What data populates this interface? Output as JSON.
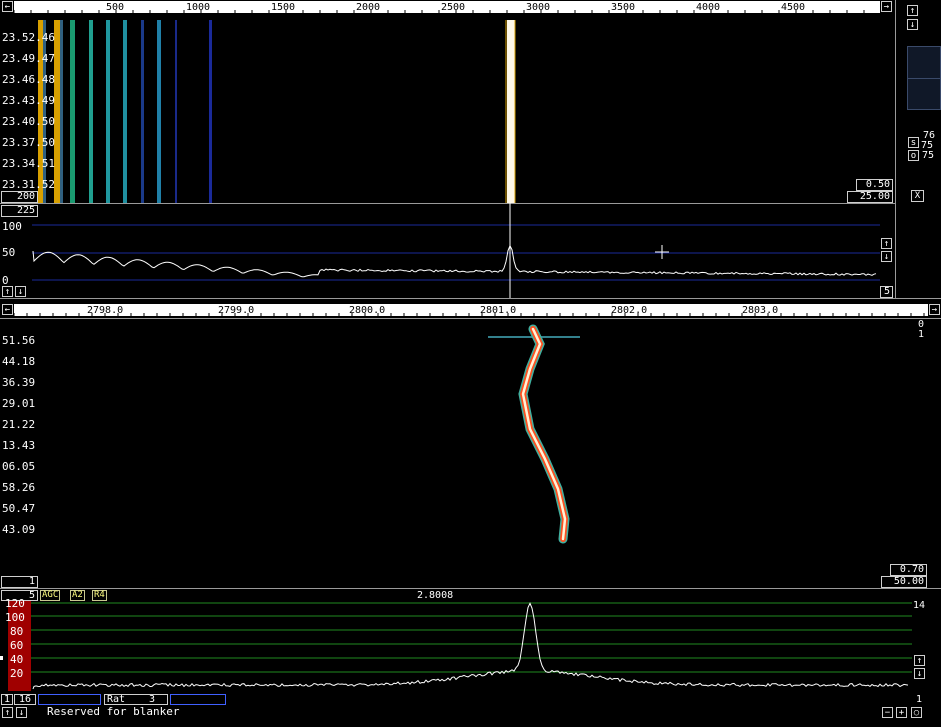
{
  "top_scale": {
    "ticks": [
      "500",
      "1000",
      "1500",
      "2000",
      "2500",
      "3000",
      "3500",
      "4000",
      "4500"
    ]
  },
  "waterfall_times": [
    "23.52.46",
    "23.49.47",
    "23.46.48",
    "23.43.49",
    "23.40.50",
    "23.37.50",
    "23.34.51",
    "23.31.52"
  ],
  "waterfall_gain": "0.50",
  "waterfall_zero": "25.00",
  "wf_bottom_left": "200",
  "spec_top_left": "225",
  "spectrum_y": [
    "100",
    "50",
    "0"
  ],
  "spec_right_value": "5",
  "side_values": [
    "76",
    "75",
    "75"
  ],
  "side_labels": [
    "s",
    "o"
  ],
  "close_label": "X",
  "mid_scale": {
    "ticks": [
      "2798.0",
      "2799.0",
      "2800.0",
      "2801.0",
      "2802.0",
      "2803.0"
    ]
  },
  "hires_times": [
    "51.56",
    "44.18",
    "36.39",
    "29.01",
    "21.22",
    "13.43",
    "06.05",
    "58.26",
    "50.47",
    "43.09"
  ],
  "hires_right_top": [
    "0",
    "1"
  ],
  "hires_gain": "0.70",
  "hires_zero": "50.00",
  "hires_left_box": "1",
  "bottom_bar": {
    "left_box": "5",
    "tags": [
      "AGC",
      "A2",
      "R4"
    ],
    "frequency": "2.8008"
  },
  "bottom_spectrum_y": [
    "120",
    "100",
    "80",
    "60",
    "40",
    "20"
  ],
  "bottom_right_top": "14",
  "bottom_right_bottom": "1",
  "status": {
    "box1": "1",
    "box2": "16",
    "rat_label": "Rat",
    "rat_value": "3",
    "message": "Reserved for blanker"
  },
  "bottom_ctrl": [
    "−",
    "+",
    "○"
  ],
  "arrows": {
    "up": "↑",
    "down": "↓",
    "left": "←",
    "right": "→"
  },
  "colors": {
    "grid_blue": "#1a2a9a",
    "grid_green": "#1f8a1f",
    "peak_red": "#ff3300",
    "signal_white": "#ffffff"
  }
}
